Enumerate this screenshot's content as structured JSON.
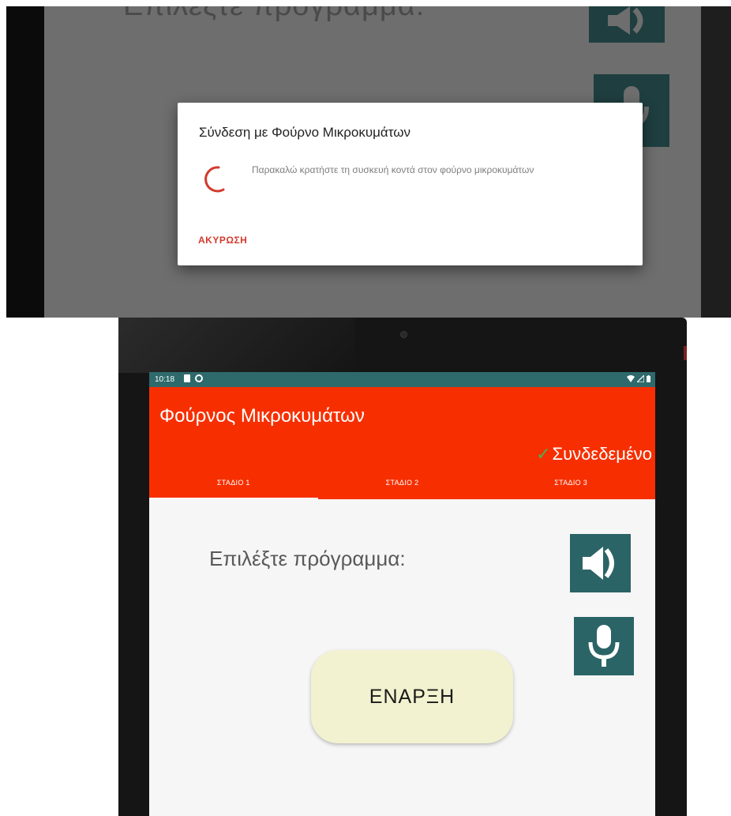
{
  "dialog_screen": {
    "background_title": "Επιλέξτε πρόγραμμα:",
    "dialog": {
      "title": "Σύνδεση με Φούρνο Μικροκυμάτων",
      "message": "Παρακαλώ κρατήστε τη συσκευή κοντά στον φούρνο μικροκυμάτων",
      "cancel_label": "ΑΚΥΡΩΣΗ"
    }
  },
  "app_screen": {
    "status_bar": {
      "time": "10:18"
    },
    "app_bar": {
      "title": "Φούρνος Μικροκυμάτων",
      "connection_status": "Συνδεδεμένο",
      "check_mark": "✓"
    },
    "tabs": [
      {
        "label": "ΣΤΑΔΙΟ 1",
        "active": true
      },
      {
        "label": "ΣΤΑΔΙΟ 2",
        "active": false
      },
      {
        "label": "ΣΤΑΔΙΟ 3",
        "active": false
      }
    ],
    "content": {
      "program_label": "Επιλέξτε πρόγραμμα:",
      "start_label": "ΕΝΑΡΞΗ"
    },
    "icons": {
      "speaker": "speaker-icon",
      "microphone": "microphone-icon"
    }
  },
  "colors": {
    "app_bar": "#f72f00",
    "status_bar": "#2e6a6b",
    "icon_button": "#2a6466",
    "start_button": "#f2f2d0",
    "cancel_text": "#d23b2e",
    "check": "#4caf50"
  }
}
